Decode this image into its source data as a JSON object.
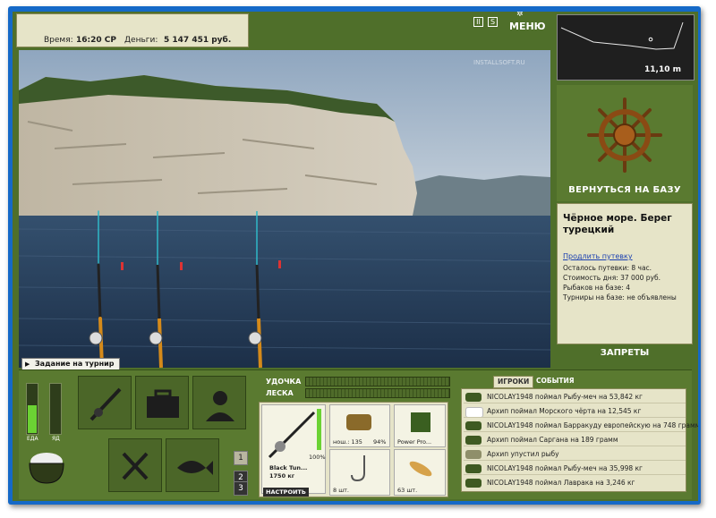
{
  "status": {
    "time_label": "Время:",
    "time_value": "16:20 СР",
    "money_label": "Деньги:",
    "money_value": "5 147 451 руб."
  },
  "topbar": {
    "pause_label": "II",
    "settings_label": "S",
    "menu_label": "МЕНЮ"
  },
  "watermark": "INSTALLSOFT.RU",
  "task_label": "Задание на турнир",
  "depth": {
    "value": "11,10 m"
  },
  "sidebar": {
    "return_label": "ВЕРНУТЬСЯ НА БАЗУ",
    "location_title": "Чёрное море. Берег турецкий",
    "extend_link": "Продлить путевку",
    "lines": [
      "Осталось путевки: 8 час.",
      "Стоимость дня: 37 000 руб.",
      "Рыбаков на базе: 4",
      "Турниры на базе: не объявлены"
    ],
    "bans_label": "ЗАПРЕТЫ"
  },
  "gauges": {
    "food_label": "ЕДА",
    "poison_label": "ЯД",
    "food_level": 0.55,
    "poison_level": 0
  },
  "numbers": [
    "1",
    "2",
    "3"
  ],
  "tension": {
    "rod_label": "УДОЧКА",
    "line_label": "ЛЕСКА"
  },
  "tackle": {
    "rod_name": "Black Tun...",
    "rod_weight": "1750 кг",
    "rod_percent": "100%",
    "reel_label": "нош.: 135",
    "reel_percent": "94%",
    "lure_name": "Power Pro...",
    "hook_count": "8 шт.",
    "bait_count": "63 шт.",
    "setup_label": "НАСТРОИТЬ"
  },
  "events": {
    "tab_players": "ИГРОКИ",
    "tab_events": "СОБЫТИЯ",
    "items": [
      "NICOLAY1948 поймал Рыбу-меч на 53,842 кг",
      "Архип поймал Морского чёрта на 12,545 кг",
      "NICOLAY1948 поймал Барракуду европейскую на 748 грамм",
      "Архип поймал Саргана на 189 грамм",
      "Архип упустил рыбу",
      "NICOLAY1948 поймал Рыбу-меч на 35,998 кг",
      "NICOLAY1948 поймал Лаврака на 3,246 кг"
    ]
  },
  "colors": {
    "panel": "#e6e4c8",
    "green": "#5a7a30",
    "gauge": "#6bd233"
  }
}
